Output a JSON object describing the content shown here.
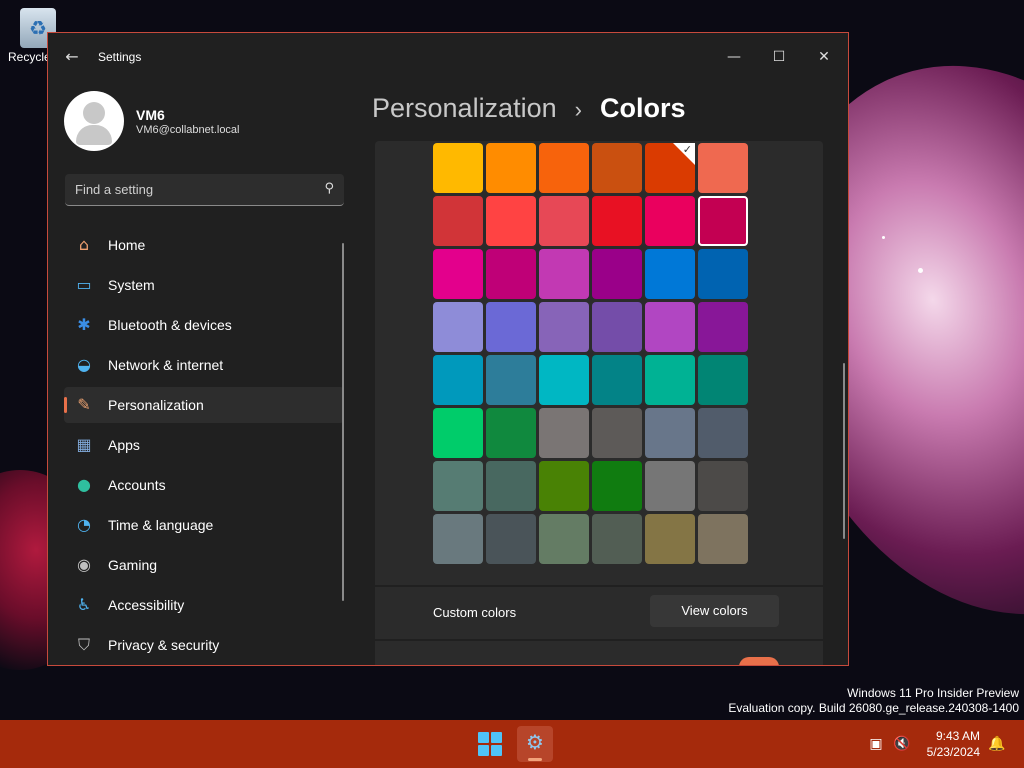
{
  "desktop": {
    "recycle_bin_label": "Recycle"
  },
  "window": {
    "title": "Settings"
  },
  "profile": {
    "name": "VM6",
    "email": "VM6@collabnet.local"
  },
  "search": {
    "placeholder": "Find a setting"
  },
  "nav": [
    {
      "label": "Home",
      "icon": "home-icon",
      "glyph": "⌂",
      "color": "#f0a070"
    },
    {
      "label": "System",
      "icon": "monitor-icon",
      "glyph": "▭",
      "color": "#4fb3f0"
    },
    {
      "label": "Bluetooth & devices",
      "icon": "bluetooth-icon",
      "glyph": "✱",
      "color": "#3a8ee6"
    },
    {
      "label": "Network & internet",
      "icon": "wifi-icon",
      "glyph": "◒",
      "color": "#4fb3f0"
    },
    {
      "label": "Personalization",
      "icon": "brush-icon",
      "glyph": "✎",
      "color": "#e8a070",
      "active": true
    },
    {
      "label": "Apps",
      "icon": "apps-icon",
      "glyph": "▦",
      "color": "#7fa8d8"
    },
    {
      "label": "Accounts",
      "icon": "person-icon",
      "glyph": "●",
      "color": "#2fbf9f"
    },
    {
      "label": "Time & language",
      "icon": "globe-clock-icon",
      "glyph": "◔",
      "color": "#4fb3f0"
    },
    {
      "label": "Gaming",
      "icon": "gamepad-icon",
      "glyph": "◉",
      "color": "#bfbfbf"
    },
    {
      "label": "Accessibility",
      "icon": "accessibility-icon",
      "glyph": "♿",
      "color": "#4fb3f0"
    },
    {
      "label": "Privacy & security",
      "icon": "shield-icon",
      "glyph": "⛉",
      "color": "#bfbfbf"
    }
  ],
  "breadcrumb": {
    "parent": "Personalization",
    "separator": "›",
    "current": "Colors"
  },
  "accent_colors": [
    "#ffb900",
    "#ff8c00",
    "#f7630c",
    "#ca5010",
    "#da3b01",
    "#ef6950",
    "#d13438",
    "#ff4343",
    "#e74856",
    "#e81123",
    "#ea005e",
    "#c30052",
    "#e3008c",
    "#bf0077",
    "#c239b3",
    "#9a0089",
    "#0078d7",
    "#0063b1",
    "#8e8cd8",
    "#6b69d6",
    "#8764b8",
    "#744da9",
    "#b146c2",
    "#881798",
    "#0099bc",
    "#2d7d9a",
    "#00b7c3",
    "#038387",
    "#00b294",
    "#018574",
    "#00cc6a",
    "#10893e",
    "#7a7574",
    "#5d5a58",
    "#68768a",
    "#515c6b",
    "#567c73",
    "#486860",
    "#498205",
    "#107c10",
    "#767676",
    "#4c4a48",
    "#69797e",
    "#4a5459",
    "#647c64",
    "#525e54",
    "#847545",
    "#7e735f"
  ],
  "selected_index": 4,
  "hover_index": 11,
  "custom_colors": {
    "label": "Custom colors",
    "button": "View colors"
  },
  "watermark": {
    "line1": "Windows 11 Pro Insider Preview",
    "line2": "Evaluation copy. Build 26080.ge_release.240308-1400"
  },
  "taskbar": {
    "time": "9:43 AM",
    "date": "5/23/2024"
  }
}
